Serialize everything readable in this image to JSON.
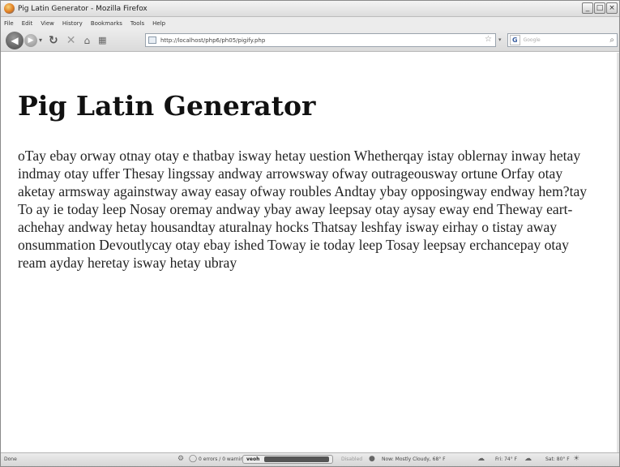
{
  "window": {
    "title": "Pig Latin Generator - Mozilla Firefox",
    "controls": {
      "minimize": "_",
      "maximize": "□",
      "close": "×"
    }
  },
  "menu": {
    "items": [
      "File",
      "Edit",
      "View",
      "History",
      "Bookmarks",
      "Tools",
      "Help"
    ]
  },
  "toolbar": {
    "back_icon": "back-arrow-icon",
    "forward_icon": "forward-arrow-icon",
    "reload_icon": "reload-icon",
    "stop_icon": "stop-icon",
    "home_icon": "home-icon",
    "url": "http://localhost/php6/ph05/pigify.php",
    "search": {
      "engine_label": "G",
      "placeholder": "Google"
    }
  },
  "page": {
    "heading": "Pig Latin Generator",
    "text": "oTay ebay orway otnay otay e thatbay isway hetay uestion Whetherqay istay oblernay inway hetay indmay otay uffer Thesay lingssay andway arrowsway ofway outrageousway ortune Orfay otay aketay armsway againstway away easay ofway roubles Andtay ybay opposingway endway hem?tay To ay ie today leep Nosay oremay andway ybay away leepsay otay aysay eway end Theway eart-achehay andway hetay housandtay aturalnay hocks Thatsay leshfay isway eirhay o tistay away onsummation Devoutlycay otay ebay ished Toway ie today leep Tosay leepsay erchancepay otay ream ayday heretay isway hetay ubray"
  },
  "status": {
    "left": "Done",
    "errors": "0 errors / 0 warnings",
    "veoh_label": "veoh",
    "disabled": "Disabled",
    "weather_now": "Now: Mostly Cloudy, 68° F",
    "weather_fri": "Fri: 74° F",
    "weather_sat": "Sat: 80° F"
  }
}
